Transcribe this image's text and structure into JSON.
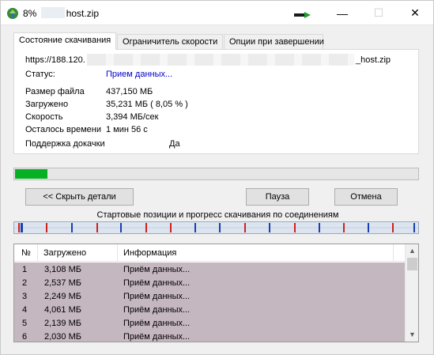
{
  "window": {
    "title_percent": "8%",
    "title_file": "host.zip"
  },
  "window_controls": {
    "minimize": "—",
    "maximize": "☐",
    "close": "✕"
  },
  "tabs": [
    {
      "label": "Состояние скачивания",
      "active": true
    },
    {
      "label": "Ограничитель скорости",
      "active": false
    },
    {
      "label": "Опции при завершении",
      "active": false
    }
  ],
  "details": {
    "url_prefix": "https://188.120.",
    "url_suffix": "_host.zip",
    "status_label": "Статус:",
    "status_value": "Прием данных...",
    "file_size_label": "Размер файла",
    "file_size_value": "437,150 МБ",
    "downloaded_label": "Загружено",
    "downloaded_value": "35,231 МБ  ( 8,05 % )",
    "speed_label": "Скорость",
    "speed_value": "3,394 МБ/сек",
    "time_left_label": "Осталось времени",
    "time_left_value": "1 мин 56 с",
    "resume_label": "Поддержка докачки",
    "resume_value": "Да"
  },
  "progress": {
    "percent": 8.05,
    "color": "#06b025"
  },
  "buttons": {
    "hide_details": "<< Скрыть детали",
    "pause": "Пауза",
    "cancel": "Отмена"
  },
  "connections_caption": "Стартовые позиции и прогресс скачивания по соединениям",
  "table": {
    "headers": {
      "num": "№",
      "downloaded": "Загружено",
      "info": "Информация"
    },
    "rows": [
      {
        "num": "1",
        "downloaded": "3,108 МБ",
        "info": "Приём данных..."
      },
      {
        "num": "2",
        "downloaded": "2,537 МБ",
        "info": "Приём данных..."
      },
      {
        "num": "3",
        "downloaded": "2,249 МБ",
        "info": "Приём данных..."
      },
      {
        "num": "4",
        "downloaded": "4,061 МБ",
        "info": "Приём данных..."
      },
      {
        "num": "5",
        "downloaded": "2,139 МБ",
        "info": "Приём данных..."
      },
      {
        "num": "6",
        "downloaded": "2,030 МБ",
        "info": "Приём данных..."
      }
    ],
    "row_color": "#c5b7c0"
  }
}
